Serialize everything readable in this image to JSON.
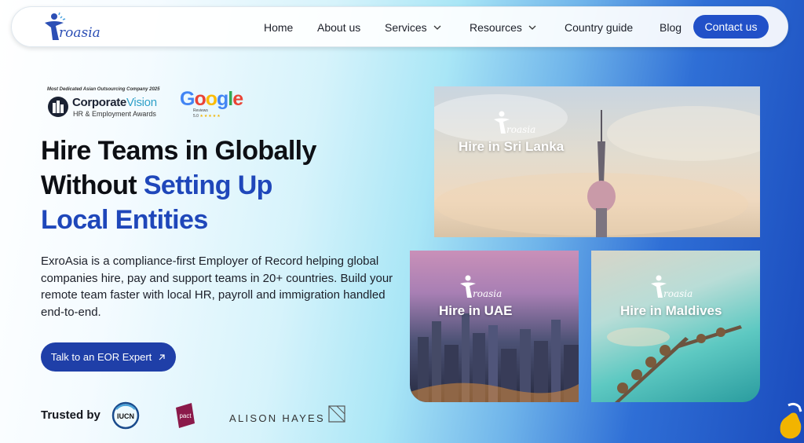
{
  "brand": {
    "logo_text": "roasia"
  },
  "nav": {
    "items": [
      {
        "label": "Home",
        "has_dropdown": false
      },
      {
        "label": "About us",
        "has_dropdown": false
      },
      {
        "label": "Services",
        "has_dropdown": true
      },
      {
        "label": "Resources",
        "has_dropdown": true
      },
      {
        "label": "Country guide",
        "has_dropdown": false
      },
      {
        "label": "Blog",
        "has_dropdown": false
      }
    ],
    "contact_label": "Contact us"
  },
  "awards": {
    "corporate_vision": {
      "tagline": "Most Dedicated Asian Outsourcing Company 2025",
      "title_main": "Corporate",
      "title_accent": "Vision",
      "subtitle": "HR & Employment Awards"
    },
    "google": {
      "wordmark": "Google",
      "reviews_label": "Reviews",
      "rating": "5.0",
      "stars": "★★★★★"
    }
  },
  "hero": {
    "headline_line1": "Hire Teams in Globally",
    "headline_line2_black": "Without ",
    "headline_line2_blue": "Setting Up",
    "headline_line3_blue": "Local Entities",
    "description": "ExroAsia is a compliance-first Employer of Record helping global companies hire, pay and support teams in 20+ countries. Build your remote team faster with local HR, payroll and immigration handled end-to-end.",
    "cta_label": "Talk to an EOR Expert",
    "cta_icon": "arrow-up-right-icon"
  },
  "trusted": {
    "label": "Trusted by",
    "logos": [
      "IUCN",
      "pact",
      "ALISON HAYES"
    ]
  },
  "cards": [
    {
      "label": "Hire in Sri Lanka",
      "logo_text": "roasia"
    },
    {
      "label": "Hire in UAE",
      "logo_text": "roasia"
    },
    {
      "label": "Hire in Maldives",
      "logo_text": "roasia"
    }
  ],
  "colors": {
    "primary": "#2150c8",
    "cta": "#1f3fa8",
    "headline_blue": "#1f47ba",
    "text": "#1c1f29"
  }
}
